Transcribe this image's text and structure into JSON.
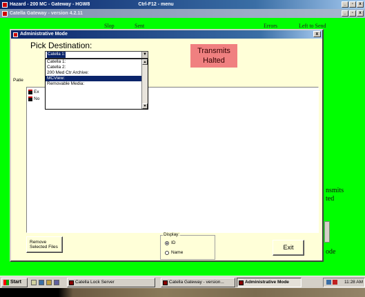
{
  "app": {
    "title": "Hazard - 200 MC - Gateway - HGW8",
    "menu_hint": "Ctrl-F12 - menu",
    "subtitle": "Catella Gateway - version 4.2.11"
  },
  "background": {
    "headers": [
      "Slop",
      "Sent",
      "Errors",
      "Left to Send"
    ],
    "right_texts": [
      "nsmits",
      "ted",
      "ode"
    ]
  },
  "dialog": {
    "title": "Administrative Mode",
    "close": "x",
    "pick_label": "Pick Destination:",
    "status": {
      "line1": "Transmits",
      "line2": "Halted"
    },
    "combo_value": "Catella 1:",
    "dropdown_options": [
      "Catella 1:",
      "Catella 2:",
      "200 Med Ctr Archive:",
      "MCView:",
      "Removable Media:"
    ],
    "dropdown_selected_index": 3,
    "patient_label": "Patie",
    "list_rows": [
      "Ex",
      "No"
    ],
    "remove_button": {
      "line1": "Remove",
      "line2": "Selected Files"
    },
    "display_group": {
      "label": "Display:",
      "options": [
        "ID",
        "Name"
      ],
      "selected": "ID"
    },
    "exit_button": "Exit"
  },
  "taskbar": {
    "start": "Start",
    "tasks": [
      "Catella Lock Server",
      "Catella Gateway - version...",
      "Administrative Mode"
    ],
    "active_task": "Administrative Mode",
    "clock": "11:28 AM"
  },
  "colors": {
    "desktop_green": "#00ff00",
    "dialog_bg": "#ffffd8",
    "halted_bg": "#f08080",
    "titlebar": "#0a246a"
  }
}
